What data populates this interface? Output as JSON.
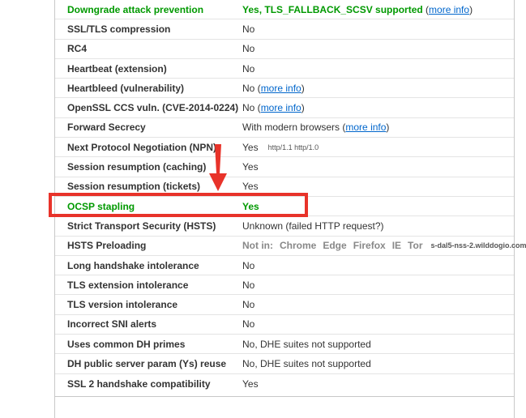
{
  "rows": [
    {
      "label": "Downgrade attack prevention",
      "value": "Yes, TLS_FALLBACK_SCSV supported",
      "pre": " (",
      "link": "more info",
      "post": ")",
      "green": true
    },
    {
      "label": "SSL/TLS compression",
      "value": "No"
    },
    {
      "label": "RC4",
      "value": "No"
    },
    {
      "label": "Heartbeat (extension)",
      "value": "No"
    },
    {
      "label": "Heartbleed (vulnerability)",
      "value": "No",
      "pre": " (",
      "link": "more info",
      "post": ")"
    },
    {
      "label": "OpenSSL CCS vuln. (CVE-2014-0224)",
      "value": "No",
      "pre": " (",
      "link": "more info",
      "post": ")"
    },
    {
      "label": "Forward Secrecy",
      "value": "With modern browsers",
      "pre": " (",
      "link": "more info",
      "post": ")"
    },
    {
      "label": "Next Protocol Negotiation (NPN)",
      "value": "Yes",
      "small": "http/1.1 http/1.0"
    },
    {
      "label": "Session resumption (caching)",
      "value": "Yes"
    },
    {
      "label": "Session resumption (tickets)",
      "value": "Yes"
    },
    {
      "label": "OCSP stapling",
      "value": "Yes",
      "green": true
    },
    {
      "label": "Strict Transport Security (HSTS)",
      "value": "Unknown (failed HTTP request?)"
    },
    {
      "label": "HSTS Preloading",
      "value": "Not in:",
      "browsers": [
        "Chrome",
        "Edge",
        "Firefox",
        "IE",
        "Tor"
      ],
      "host": "s-dal5-nss-2.wilddogio.com"
    },
    {
      "label": "Long handshake intolerance",
      "value": "No"
    },
    {
      "label": "TLS extension intolerance",
      "value": "No"
    },
    {
      "label": "TLS version intolerance",
      "value": "No"
    },
    {
      "label": "Incorrect SNI alerts",
      "value": "No"
    },
    {
      "label": "Uses common DH primes",
      "value": "No, DHE suites not supported"
    },
    {
      "label": "DH public server param (Ys) reuse",
      "value": "No, DHE suites not supported"
    },
    {
      "label": "SSL 2 handshake compatibility",
      "value": "Yes"
    }
  ],
  "colors": {
    "green": "#009900",
    "link": "#0066cc",
    "highlight": "#e8332a"
  },
  "annotation": {
    "icon": "arrow-down-icon"
  }
}
